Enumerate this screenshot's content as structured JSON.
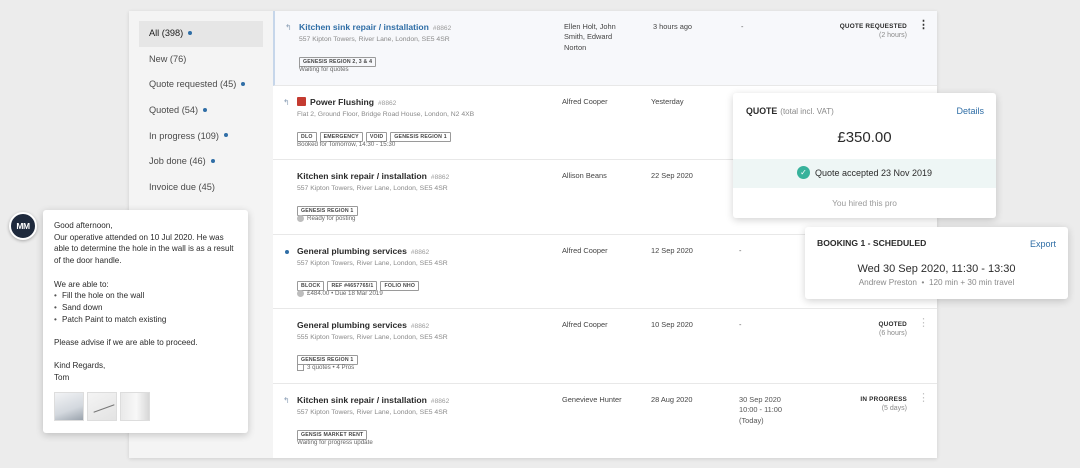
{
  "sidebar": {
    "filters": [
      {
        "label": "All (398)",
        "dot": true,
        "active": true
      },
      {
        "label": "New (76)",
        "dot": false,
        "active": false
      },
      {
        "label": "Quote requested (45)",
        "dot": true,
        "active": false
      },
      {
        "label": "Quoted (54)",
        "dot": true,
        "active": false
      },
      {
        "label": "In progress (109)",
        "dot": true,
        "active": false
      },
      {
        "label": "Job done (46)",
        "dot": true,
        "active": false
      },
      {
        "label": "Invoice due (45)",
        "dot": false,
        "active": false
      }
    ]
  },
  "jobs": [
    {
      "title": "Kitchen sink repair / installation",
      "job_id": "#8862",
      "address": "557 Kipton Towers, River Lane, London, SE5 4SR",
      "tags": [
        "GENESIS REGION 2, 3 & 4"
      ],
      "footer": "Waiting for quotes",
      "people": "Ellen Holt, John Smith, Edward Norton",
      "time": "3 hours ago",
      "appointment": "-",
      "status": "QUOTE REQUESTED",
      "status_sub": "(2 hours)"
    },
    {
      "title": "Power Flushing",
      "job_id": "#8862",
      "address": "Flat 2, Ground Floor, Bridge Road House, London, N2 4XB",
      "tags": [
        "DLO",
        "EMERGENCY",
        "VOID",
        "GENESIS REGION 1"
      ],
      "footer": "Booked for Tomorrow, 14:30 - 15:30",
      "people": "Alfred Cooper",
      "time": "Yesterday"
    },
    {
      "title": "Kitchen sink repair / installation",
      "job_id": "#8862",
      "address": "557 Kipton Towers, River Lane, London, SE5 4SR",
      "tags": [
        "GENESIS REGION 1"
      ],
      "footer": "Ready for posting",
      "people": "Allison Beans",
      "time": "22 Sep 2020"
    },
    {
      "title": "General plumbing services",
      "job_id": "#8862",
      "address": "557 Kipton Towers, River Lane, London, SE5 4SR",
      "tags": [
        "BLOCK",
        "REF #4657765/1",
        "FOLIO NHO"
      ],
      "footer": "£484.00  •  Due 18 Mar 2019",
      "people": "Alfred Cooper",
      "time": "12 Sep 2020",
      "appointment": "-"
    },
    {
      "title": "General plumbing services",
      "job_id": "#8862",
      "address": "555 Kipton Towers, River Lane, London, SE5 4SR",
      "tags": [
        "GENESIS REGION 1"
      ],
      "footer": "3 quotes  •  4 Pros",
      "people": "Alfred Cooper",
      "time": "10 Sep 2020",
      "appointment": "-",
      "status": "QUOTED",
      "status_sub": "(6 hours)"
    },
    {
      "title": "Kitchen sink repair / installation",
      "job_id": "#8862",
      "address": "557 Kipton Towers, River Lane, London, SE5 4SR",
      "tags": [
        "GENSIS MARKET RENT"
      ],
      "footer": "Waiting for progress update",
      "people": "Genevieve Hunter",
      "time": "28 Aug 2020",
      "appointment_lines": [
        "30 Sep 2020",
        "10:00 - 11:00",
        "(Today)"
      ],
      "status": "IN PROGRESS",
      "status_sub": "(5 days)"
    }
  ],
  "quote_card": {
    "label": "QUOTE",
    "sublabel": "(total incl. VAT)",
    "link": "Details",
    "amount": "£350.00",
    "accepted": "Quote accepted 23 Nov 2019",
    "footer": "You hired this pro"
  },
  "booking_card": {
    "label": "BOOKING 1 - SCHEDULED",
    "link": "Export",
    "datetime": "Wed 30 Sep 2020, 11:30 - 13:30",
    "pro": "Andrew Preston",
    "duration": "120 min + 30 min travel"
  },
  "avatar": {
    "initials": "MM"
  },
  "message": {
    "greeting": "Good afternoon,",
    "body": "Our operative attended on 10 Jul 2020. He was able to determine the hole in the wall is as a result of the door handle.",
    "list_intro": "We are able to:",
    "items": [
      "Fill the hole on the wall",
      "Sand down",
      "Patch Paint to match existing"
    ],
    "closing": "Please advise if we are able to proceed.",
    "signoff": "Kind Regards,",
    "signature": "Tom"
  },
  "colors": {
    "accent": "#2f6ea6",
    "success": "#37b29b",
    "urgent": "#c43b31"
  }
}
